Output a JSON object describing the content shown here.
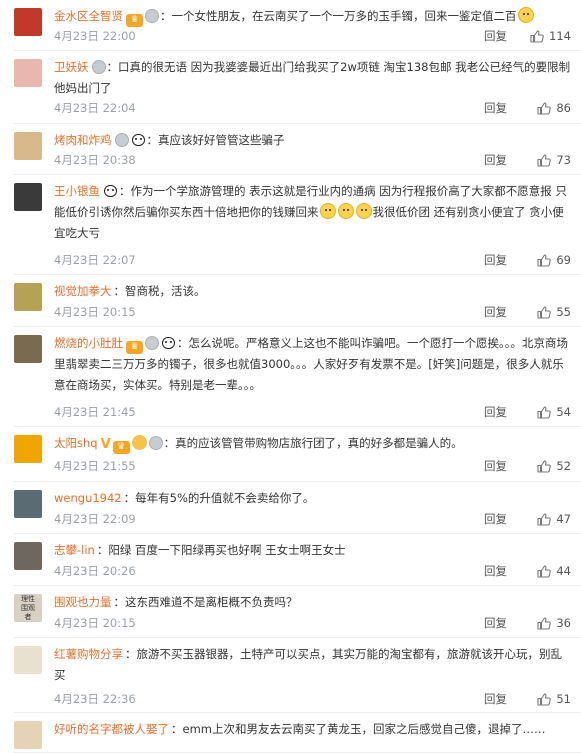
{
  "ui": {
    "reply_label": "回复"
  },
  "comments": [
    {
      "name": "金水区全智贤",
      "badges": [
        "vip",
        "medal"
      ],
      "text": "：一个女性朋友，在云南买了一个一万多的玉手镯，回来一鉴定值二百",
      "emoji_after": 1,
      "time": "4月23日 22:00",
      "likes": "114",
      "avatar_color": "#c0392b"
    },
    {
      "name": "卫妖妖",
      "badges": [
        "medal"
      ],
      "text": "：口真的很无语 因为我婆婆最近出门给我买了2w项链 淘宝138包邮 我老公已经气的要限制他妈出门了",
      "emoji_after": 0,
      "time": "4月23日 22:04",
      "likes": "86",
      "avatar_color": "#e8b7b0"
    },
    {
      "name": "烤肉和炸鸡",
      "badges": [
        "medal",
        "panda"
      ],
      "text": "：真应该好好管管这些骗子",
      "emoji_after": 0,
      "time": "4月23日 20:38",
      "likes": "73",
      "avatar_color": "#d9b98c"
    },
    {
      "name": "王小银鱼",
      "badges": [
        "panda"
      ],
      "text": "：作为一个学旅游管理的 表示这就是行业内的通病 因为行程报价高了大家都不愿意报 只能低价引诱你然后骗你买东西十倍地把你的钱赚回来",
      "emoji_after": 3,
      "text2": "我很低价团 还有别贪小便宜了 贪小便宜吃大亏",
      "time": "4月23日 22:07",
      "likes": "69",
      "avatar_color": "#3a3a3a"
    },
    {
      "name": "视觉加拳大",
      "badges": [],
      "text": "：智商税，活该。",
      "emoji_after": 0,
      "time": "4月23日 20:15",
      "likes": "55",
      "avatar_color": "#b5a255"
    },
    {
      "name": "燃烧的小肚肚",
      "badges": [
        "vip",
        "medal",
        "panda"
      ],
      "text": "：怎么说呢。严格意义上这也不能叫诈骗吧。一个愿打一个愿挨。。。北京商场里翡翠卖二三万万多的镯子，很多也就值3000。。。人家好歹有发票不是。[奸笑]问题是，很多人就乐意在商场买，实体买。特别是老一辈。。。",
      "emoji_after": 0,
      "time": "4月23日 21:45",
      "likes": "54",
      "avatar_color": "#7a6a50"
    },
    {
      "name": "太阳shq",
      "badges": [
        "v",
        "vip",
        "gift",
        "medal"
      ],
      "text": "：真的应该管管带购物店旅行团了，真的好多都是骗人的。",
      "emoji_after": 0,
      "time": "4月23日 21:55",
      "likes": "52",
      "avatar_color": "#f0a500"
    },
    {
      "name": "wengu1942",
      "badges": [],
      "text": "：每年有5%的升值就不会卖给你了。",
      "emoji_after": 0,
      "time": "4月23日 22:09",
      "likes": "47",
      "avatar_color": "#5a6b73"
    },
    {
      "name": "志攀-lin",
      "badges": [],
      "text": "：阳绿 百度一下阳绿再买也好啊 王女士啊王女士",
      "emoji_after": 0,
      "time": "4月23日 20:26",
      "likes": "44",
      "avatar_color": "#6d6760"
    },
    {
      "name": "围观也力量",
      "badges": [],
      "text": "：这东西难道不是离柜概不负责吗？",
      "emoji_after": 0,
      "time": "4月23日 20:15",
      "likes": "36",
      "avatar_color": "#d8d2c4",
      "avatar_text": "理性围观者"
    },
    {
      "name": "红薯购物分享",
      "badges": [],
      "text": "：旅游不买玉器银器，土特产可以买点，其实万能的淘宝都有，旅游就该开心玩，别乱买",
      "emoji_after": 0,
      "time": "4月23日 22:36",
      "likes": "51",
      "avatar_color": "#e9e1d0"
    },
    {
      "name": "好听的名字都被人娶了",
      "badges": [],
      "text": "：emm上次和男友去云南买了黄龙玉，回家之后感觉自己傻，退掉了……",
      "emoji_after": 0,
      "time": "",
      "likes": "",
      "avatar_color": "#e5d3b5"
    }
  ]
}
